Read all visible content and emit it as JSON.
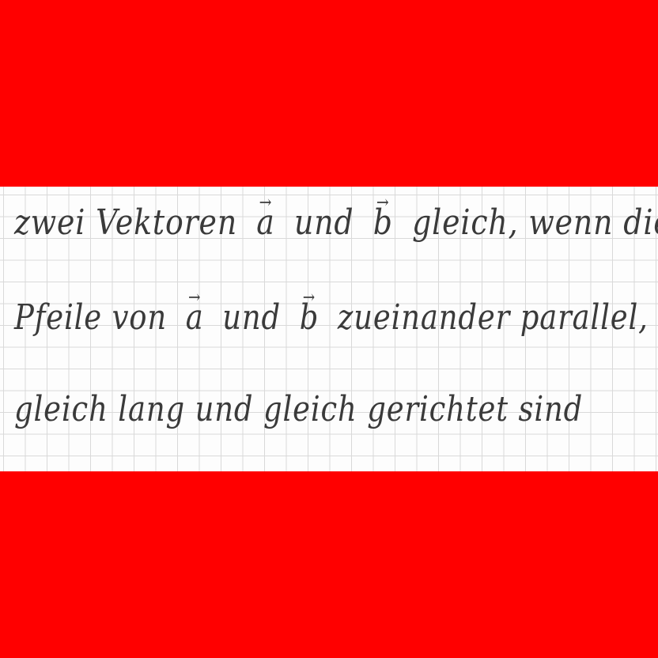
{
  "handwriting": {
    "line1": {
      "part1": "zwei Vektoren",
      "vec_a": "a",
      "part2": "und",
      "vec_b": "b",
      "part3": "gleich, wenn die"
    },
    "line2": {
      "part1": "Pfeile von",
      "vec_a": "a",
      "part2": "und",
      "vec_b": "b",
      "part3": "zueinander parallel,"
    },
    "line3": {
      "text": "gleich lang und gleich gerichtet sind"
    },
    "arrow_glyph": "→"
  },
  "colors": {
    "band": "#ff0000",
    "paper": "#fdfdfd",
    "grid": "#d9d9d9",
    "ink": "#3a3a3a"
  }
}
